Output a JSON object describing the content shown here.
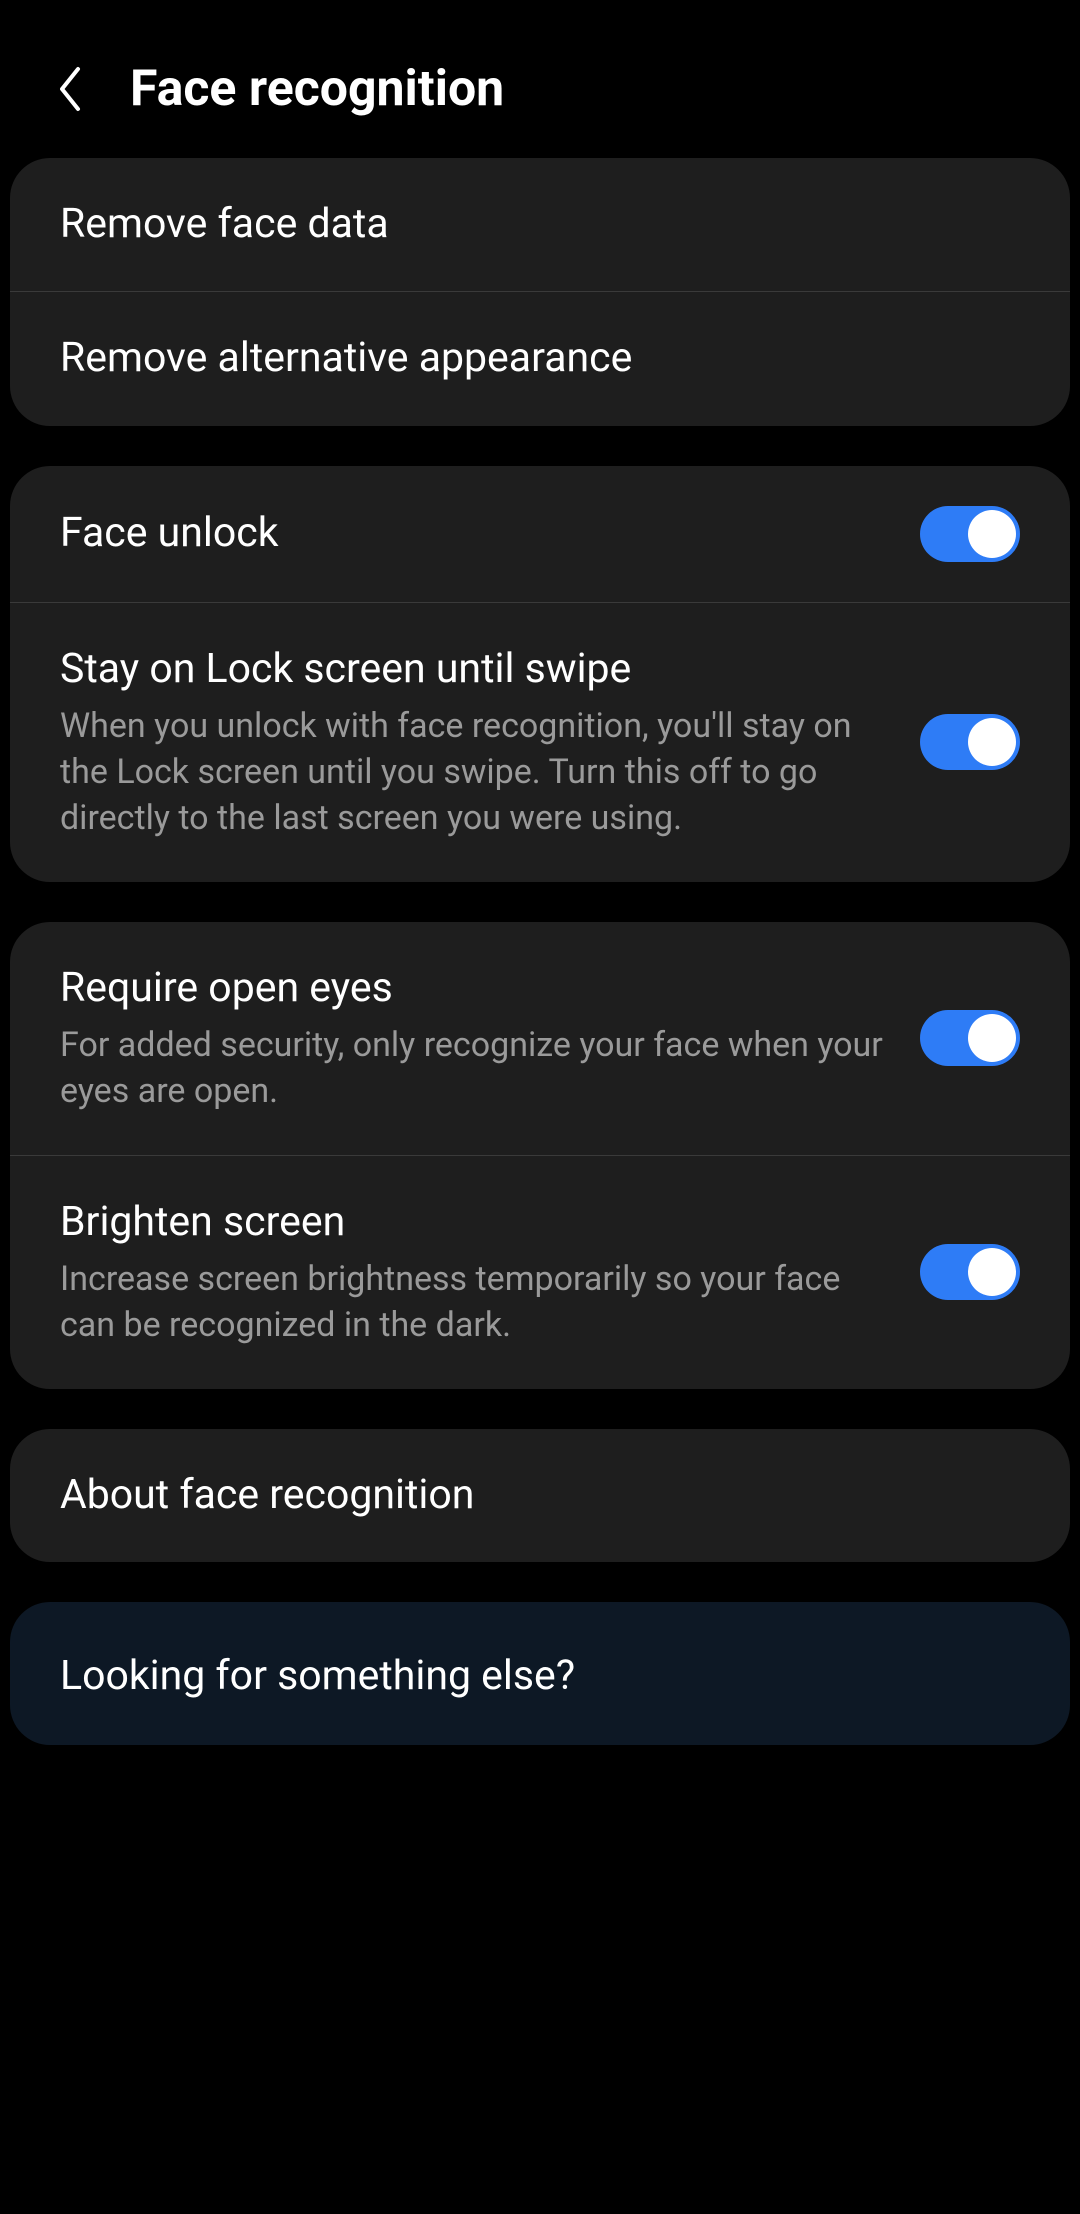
{
  "header": {
    "title": "Face recognition"
  },
  "groups": [
    {
      "items": [
        {
          "title": "Remove face data",
          "has_toggle": false
        },
        {
          "title": "Remove alternative appearance",
          "has_toggle": false
        }
      ]
    },
    {
      "items": [
        {
          "title": "Face unlock",
          "has_toggle": true,
          "toggle_on": true
        },
        {
          "title": "Stay on Lock screen until swipe",
          "subtitle": "When you unlock with face recognition, you'll stay on the Lock screen until you swipe. Turn this off to go directly to the last screen you were using.",
          "has_toggle": true,
          "toggle_on": true
        }
      ]
    },
    {
      "items": [
        {
          "title": "Require open eyes",
          "subtitle": "For added security, only recognize your face when your eyes are open.",
          "has_toggle": true,
          "toggle_on": true
        },
        {
          "title": "Brighten screen",
          "subtitle": "Increase screen brightness temporarily so your face can be recognized in the dark.",
          "has_toggle": true,
          "toggle_on": true
        }
      ]
    },
    {
      "items": [
        {
          "title": "About face recognition",
          "has_toggle": false
        }
      ]
    }
  ],
  "footer": {
    "title": "Looking for something else?"
  }
}
